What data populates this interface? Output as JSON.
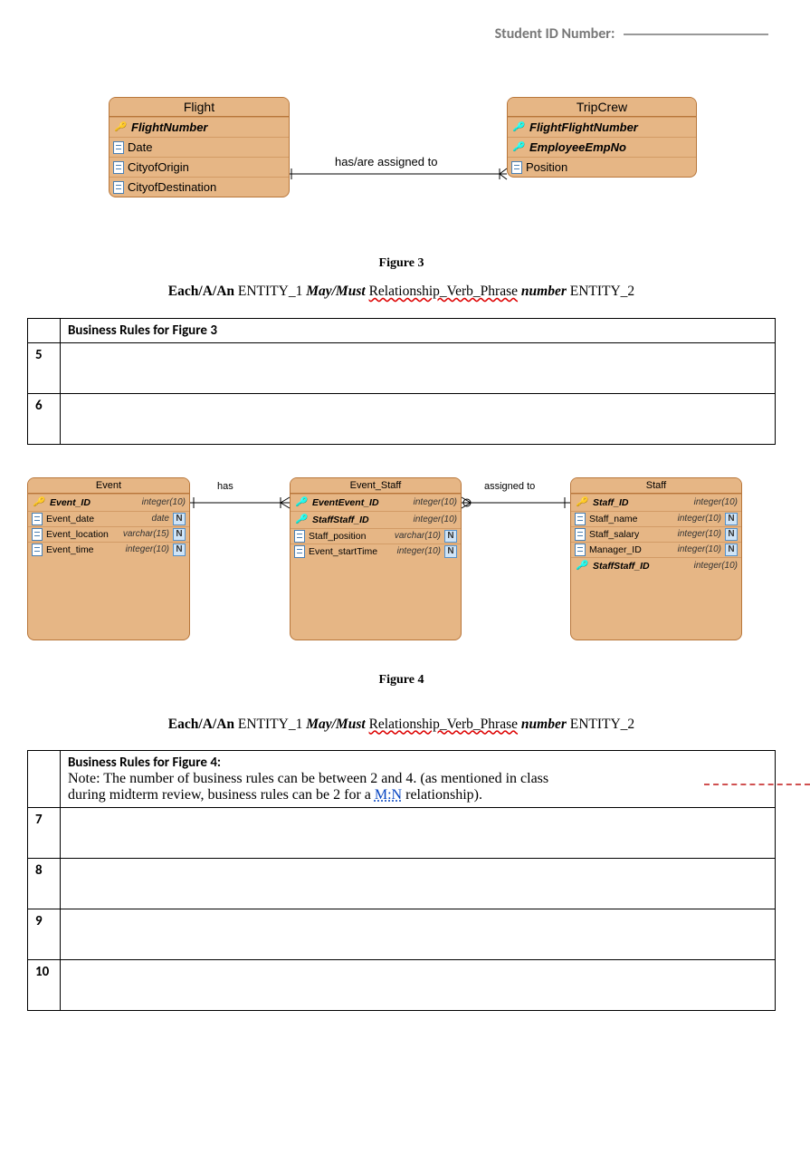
{
  "header": {
    "label": "Student ID Number:"
  },
  "figure3": {
    "caption": "Figure 3",
    "relationship_label": "has/are assigned to",
    "entities": {
      "flight": {
        "name": "Flight",
        "attrs": [
          {
            "name": "FlightNumber",
            "kind": "pk"
          },
          {
            "name": "Date",
            "kind": "col"
          },
          {
            "name": "CityofOrigin",
            "kind": "col"
          },
          {
            "name": "CityofDestination",
            "kind": "col"
          }
        ]
      },
      "tripcrew": {
        "name": "TripCrew",
        "attrs": [
          {
            "name": "FlightFlightNumber",
            "kind": "fk"
          },
          {
            "name": "EmployeeEmpNo",
            "kind": "fk"
          },
          {
            "name": "Position",
            "kind": "col"
          }
        ]
      }
    }
  },
  "sentence": {
    "each": "Each/A/An",
    "e1": "ENTITY_1",
    "maymust": "May/Must",
    "rel": "Relationship_Verb_Phrase",
    "number": "number",
    "e2": "ENTITY_2"
  },
  "table3": {
    "header": "Business Rules for Figure 3",
    "rows": [
      {
        "n": "5",
        "text": ""
      },
      {
        "n": "6",
        "text": ""
      }
    ]
  },
  "figure4": {
    "caption": "Figure 4",
    "rel_has": "has",
    "rel_assigned": "assigned to",
    "entities": {
      "event": {
        "name": "Event",
        "attrs": [
          {
            "name": "Event_ID",
            "type": "integer(10)",
            "kind": "pk",
            "null": false
          },
          {
            "name": "Event_date",
            "type": "date",
            "kind": "col",
            "null": true
          },
          {
            "name": "Event_location",
            "type": "varchar(15)",
            "kind": "col",
            "null": true
          },
          {
            "name": "Event_time",
            "type": "integer(10)",
            "kind": "col",
            "null": true
          }
        ]
      },
      "event_staff": {
        "name": "Event_Staff",
        "attrs": [
          {
            "name": "EventEvent_ID",
            "type": "integer(10)",
            "kind": "fk",
            "null": false
          },
          {
            "name": "StaffStaff_ID",
            "type": "integer(10)",
            "kind": "fk",
            "null": false
          },
          {
            "name": "Staff_position",
            "type": "varchar(10)",
            "kind": "col",
            "null": true
          },
          {
            "name": "Event_startTime",
            "type": "integer(10)",
            "kind": "col",
            "null": true
          }
        ]
      },
      "staff": {
        "name": "Staff",
        "attrs": [
          {
            "name": "Staff_ID",
            "type": "integer(10)",
            "kind": "pk",
            "null": false
          },
          {
            "name": "Staff_name",
            "type": "integer(10)",
            "kind": "col",
            "null": true
          },
          {
            "name": "Staff_salary",
            "type": "integer(10)",
            "kind": "col",
            "null": true
          },
          {
            "name": "Manager_ID",
            "type": "integer(10)",
            "kind": "col",
            "null": true
          },
          {
            "name": "StaffStaff_ID",
            "type": "integer(10)",
            "kind": "fk",
            "null": false
          }
        ]
      }
    }
  },
  "table4": {
    "header": "Business Rules for Figure 4:",
    "note_line1": "Note: The number of business rules can be between 2 and 4. (as mentioned in class",
    "note_line2_a": "during midterm review, business rules can be 2 for a ",
    "note_mn": "M:N",
    "note_line2_b": " relationship).",
    "rows": [
      {
        "n": "7",
        "text": ""
      },
      {
        "n": "8",
        "text": ""
      },
      {
        "n": "9",
        "text": ""
      },
      {
        "n": "10",
        "text": ""
      }
    ]
  }
}
